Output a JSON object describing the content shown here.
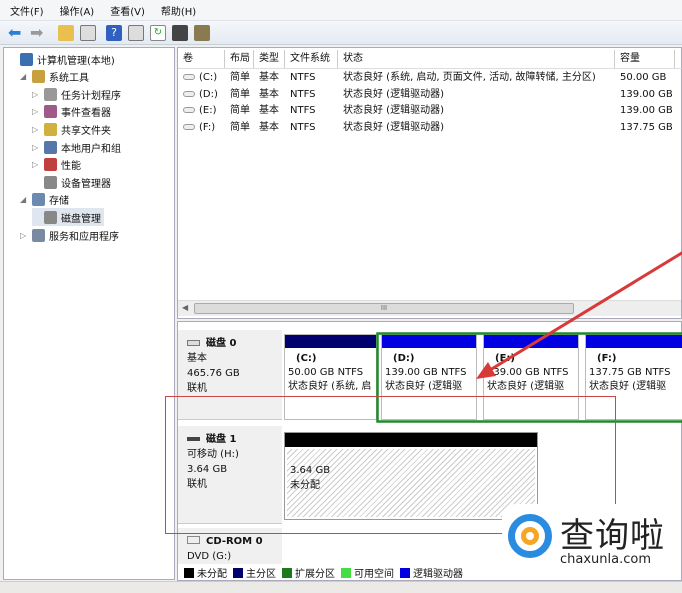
{
  "menu": [
    "文件(F)",
    "操作(A)",
    "查看(V)",
    "帮助(H)"
  ],
  "tree": [
    {
      "label": "计算机管理(本地)",
      "level": 0,
      "arrow": "",
      "color": "#3a70b0"
    },
    {
      "label": "系统工具",
      "level": 1,
      "arrow": "◢",
      "color": "#c8a040"
    },
    {
      "label": "任务计划程序",
      "level": 2,
      "arrow": "▷",
      "color": "#999"
    },
    {
      "label": "事件查看器",
      "level": 2,
      "arrow": "▷",
      "color": "#a05a8a"
    },
    {
      "label": "共享文件夹",
      "level": 2,
      "arrow": "▷",
      "color": "#d0b040"
    },
    {
      "label": "本地用户和组",
      "level": 2,
      "arrow": "▷",
      "color": "#5577aa"
    },
    {
      "label": "性能",
      "level": 2,
      "arrow": "▷",
      "color": "#c04040"
    },
    {
      "label": "设备管理器",
      "level": 2,
      "arrow": "",
      "color": "#888"
    },
    {
      "label": "存储",
      "level": 1,
      "arrow": "◢",
      "color": "#6a8ab0"
    },
    {
      "label": "磁盘管理",
      "level": 2,
      "arrow": "",
      "color": "#888",
      "selected": true
    },
    {
      "label": "服务和应用程序",
      "level": 1,
      "arrow": "▷",
      "color": "#7a8aa0"
    }
  ],
  "table": {
    "headers": [
      "卷",
      "布局",
      "类型",
      "文件系统",
      "状态",
      "容量"
    ],
    "rows": [
      [
        "(C:)",
        "简单",
        "基本",
        "NTFS",
        "状态良好 (系统, 启动, 页面文件, 活动, 故障转储, 主分区)",
        "50.00 GB"
      ],
      [
        "(D:)",
        "简单",
        "基本",
        "NTFS",
        "状态良好 (逻辑驱动器)",
        "139.00 GB"
      ],
      [
        "(E:)",
        "简单",
        "基本",
        "NTFS",
        "状态良好 (逻辑驱动器)",
        "139.00 GB"
      ],
      [
        "(F:)",
        "简单",
        "基本",
        "NTFS",
        "状态良好 (逻辑驱动器)",
        "137.75 GB"
      ]
    ],
    "scroll_grip": "III"
  },
  "disk0": {
    "name": "磁盘 0",
    "type": "基本",
    "size": "465.76 GB",
    "state": "联机",
    "partitions": [
      {
        "name": "(C:)",
        "size": "50.00 GB NTFS",
        "status": "状态良好 (系统, 启",
        "bar": "#00006e"
      },
      {
        "name": "(D:)",
        "size": "139.00 GB NTFS",
        "status": "状态良好 (逻辑驱",
        "bar": "#0000e0"
      },
      {
        "name": "(E:)",
        "size": "139.00 GB NTFS",
        "status": "状态良好 (逻辑驱",
        "bar": "#0000e0"
      },
      {
        "name": "(F:)",
        "size": "137.75 GB NTFS",
        "status": "状态良好 (逻辑驱",
        "bar": "#0000e0"
      }
    ]
  },
  "disk1": {
    "name": "磁盘 1",
    "type": "可移动 (H:)",
    "size": "3.64 GB",
    "state": "联机",
    "part_size": "3.64 GB",
    "part_status": "未分配"
  },
  "cdrom": {
    "name": "CD-ROM 0",
    "type": "DVD (G:)"
  },
  "legend": [
    {
      "label": "未分配",
      "color": "#000000"
    },
    {
      "label": "主分区",
      "color": "#00006e"
    },
    {
      "label": "扩展分区",
      "color": "#1c7a1c"
    },
    {
      "label": "可用空间",
      "color": "#44dd44"
    },
    {
      "label": "逻辑驱动器",
      "color": "#0000e0"
    }
  ],
  "watermark": {
    "name": "查询啦",
    "url": "chaxunla.com"
  }
}
